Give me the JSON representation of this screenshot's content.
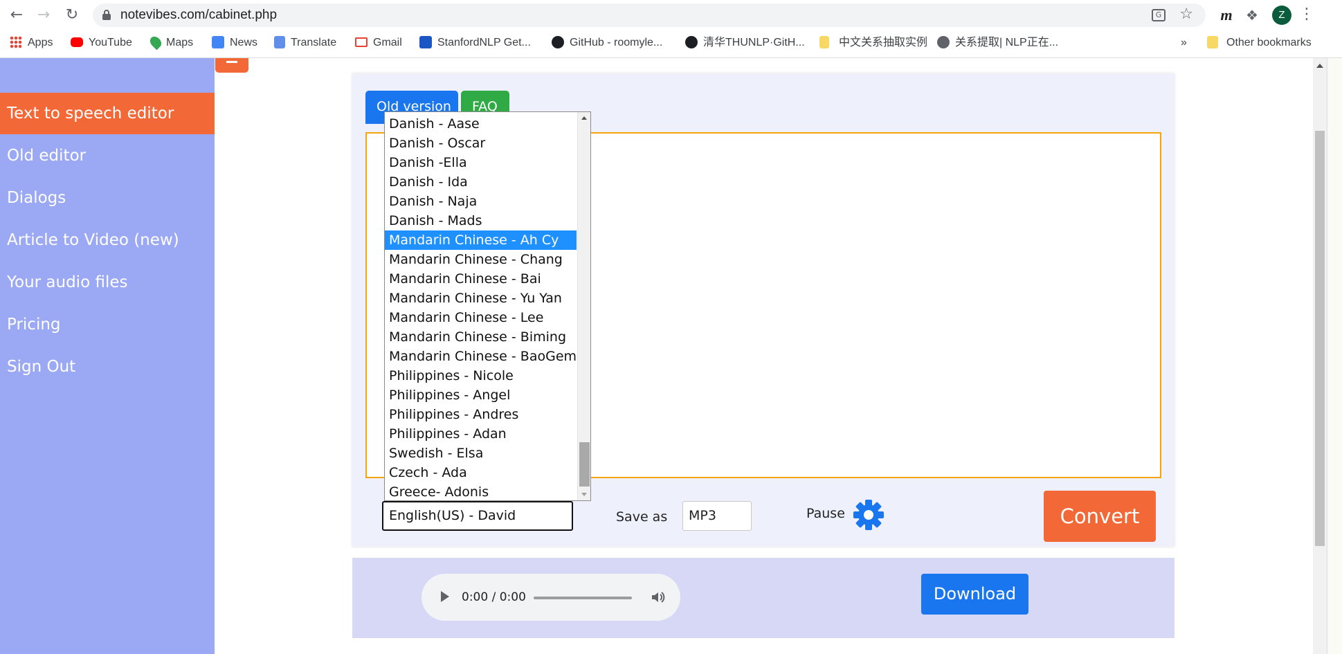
{
  "browser": {
    "url": "notevibes.com/cabinet.php",
    "profile_initial": "Z",
    "bookmarks": [
      {
        "label": "Apps",
        "icon": "apps-grid-icon"
      },
      {
        "label": "YouTube",
        "icon": "youtube-icon"
      },
      {
        "label": "Maps",
        "icon": "maps-pin-icon"
      },
      {
        "label": "News",
        "icon": "news-icon"
      },
      {
        "label": "Translate",
        "icon": "translate-icon"
      },
      {
        "label": "Gmail",
        "icon": "gmail-icon"
      },
      {
        "label": "StanfordNLP Get...",
        "icon": "ui-icon"
      },
      {
        "label": "GitHub - roomyle...",
        "icon": "github-icon"
      },
      {
        "label": "清华THUNLP·GitH...",
        "icon": "github-icon"
      },
      {
        "label": "中文关系抽取实例",
        "icon": "note-icon"
      },
      {
        "label": "关系提取| NLP正在...",
        "icon": "globe-icon"
      }
    ],
    "more_bookmarks": "»",
    "other_bookmarks": "Other bookmarks"
  },
  "sidebar": {
    "items": [
      {
        "label": "Text to speech editor",
        "active": true
      },
      {
        "label": "Old editor"
      },
      {
        "label": "Dialogs"
      },
      {
        "label": "Article to Video (new)"
      },
      {
        "label": "Your audio files"
      },
      {
        "label": "Pricing"
      },
      {
        "label": "Sign Out"
      }
    ]
  },
  "editor": {
    "old_version_label": "Old version",
    "faq_label": "FAQ",
    "voice_selected": "English(US) - David",
    "save_as_label": "Save as",
    "format_value": "MP3",
    "pause_label": "Pause",
    "convert_label": "Convert"
  },
  "voice_dropdown": {
    "options": [
      "Danish - Aase",
      "Danish - Oscar",
      "Danish -Ella",
      "Danish - Ida",
      "Danish - Naja",
      "Danish - Mads",
      "Mandarin Chinese - Ah Cy",
      "Mandarin Chinese - Chang",
      "Mandarin Chinese - Bai",
      "Mandarin Chinese - Yu Yan",
      "Mandarin Chinese - Lee",
      "Mandarin Chinese - Biming",
      "Mandarin Chinese - BaoGem",
      "Philippines - Nicole",
      "Philippines - Angel",
      "Philippines - Andres",
      "Philippines - Adan",
      "Swedish - Elsa",
      "Czech - Ada",
      "Greece- Adonis"
    ],
    "highlighted": "Mandarin Chinese - Ah Cy"
  },
  "audio": {
    "time": "0:00 / 0:00",
    "download_label": "Download"
  },
  "colors": {
    "sidebar_bg": "#9ba8f3",
    "accent_orange": "#f26836",
    "primary_blue": "#1976ee",
    "faq_green": "#2faa45",
    "editor_border": "#f4a40c",
    "selection_blue": "#1e90ff"
  }
}
